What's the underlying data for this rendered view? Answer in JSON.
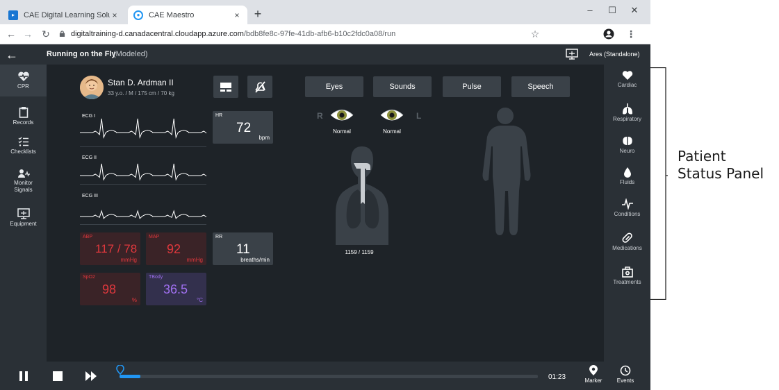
{
  "browser": {
    "tabs": [
      {
        "title": "CAE Digital Learning Solutions",
        "close": "×",
        "active": false
      },
      {
        "title": "CAE Maestro",
        "close": "×",
        "active": true
      }
    ],
    "new_tab": "+",
    "window_controls": {
      "minimize": "–",
      "maximize": "☐",
      "close": "✕"
    },
    "url_host": "digitaltraining-d.canadacentral.cloudapp.azure.com",
    "url_path": "/bdb8fe8c-97fe-41db-afb6-b10c2fdc0a08/run",
    "icons": {
      "back": "arrow-left-icon",
      "forward": "arrow-right-icon",
      "reload": "reload-icon",
      "lock": "lock-icon",
      "star": "star-icon",
      "profile": "account-icon",
      "menu": "kebab-menu-icon"
    }
  },
  "app": {
    "scenario_title": "Running on the Fly",
    "scenario_mode": "(Modeled)",
    "device": "Ares (Standalone)"
  },
  "left_nav": [
    {
      "label": "CPR",
      "icon": "heart-pulse-icon",
      "active": true
    },
    {
      "label": "Records",
      "icon": "clipboard-icon"
    },
    {
      "label": "Checklists",
      "icon": "checklist-icon"
    },
    {
      "label": "Monitor Signals",
      "icon": "monitor-signals-icon"
    },
    {
      "label": "Equipment",
      "icon": "equipment-monitor-icon"
    }
  ],
  "right_nav": [
    {
      "label": "Cardiac",
      "icon": "heart-icon"
    },
    {
      "label": "Respiratory",
      "icon": "lungs-icon"
    },
    {
      "label": "Neuro",
      "icon": "brain-icon"
    },
    {
      "label": "Fluids",
      "icon": "drop-icon"
    },
    {
      "label": "Conditions",
      "icon": "pulse-line-icon"
    },
    {
      "label": "Medications",
      "icon": "pill-icon"
    },
    {
      "label": "Treatments",
      "icon": "first-aid-kit-icon"
    }
  ],
  "patient": {
    "name": "Stan D. Ardman II",
    "demographics": "33 y.o. / M / 175 cm / 70 kg"
  },
  "ecg": [
    {
      "label": "ECG I"
    },
    {
      "label": "ECG II"
    },
    {
      "label": "ECG III"
    }
  ],
  "vitals": {
    "hr": {
      "label": "HR",
      "value": "72",
      "unit": "bpm"
    },
    "rr": {
      "label": "RR",
      "value": "11",
      "unit": "breaths/min"
    },
    "abp": {
      "label": "ABP",
      "value": "117 / 78",
      "unit": "mmHg"
    },
    "map": {
      "label": "MAP",
      "value": "92",
      "unit": "mmHg"
    },
    "spo2": {
      "label": "SpO2",
      "value": "98",
      "unit": "%"
    },
    "tbody": {
      "label": "TBody",
      "value": "36.5",
      "unit": "°C"
    }
  },
  "assessment_buttons": [
    "Eyes",
    "Sounds",
    "Pulse",
    "Speech"
  ],
  "eyes": {
    "right_side": "R",
    "left_side": "L",
    "right_state": "Normal",
    "left_state": "Normal"
  },
  "respiration_count": "1159 / 1159",
  "playback": {
    "elapsed": "01:23",
    "progress": 0.05,
    "marker_label": "Marker",
    "events_label": "Events"
  },
  "colors": {
    "accent": "#2196f3",
    "abp": "#e0383d",
    "map": "#e0383d",
    "spo2": "#e0383d",
    "tbody": "#a070f0",
    "ecg": "#ffffff"
  },
  "annotation": {
    "line1": "Patient",
    "line2": "Status Panel"
  }
}
